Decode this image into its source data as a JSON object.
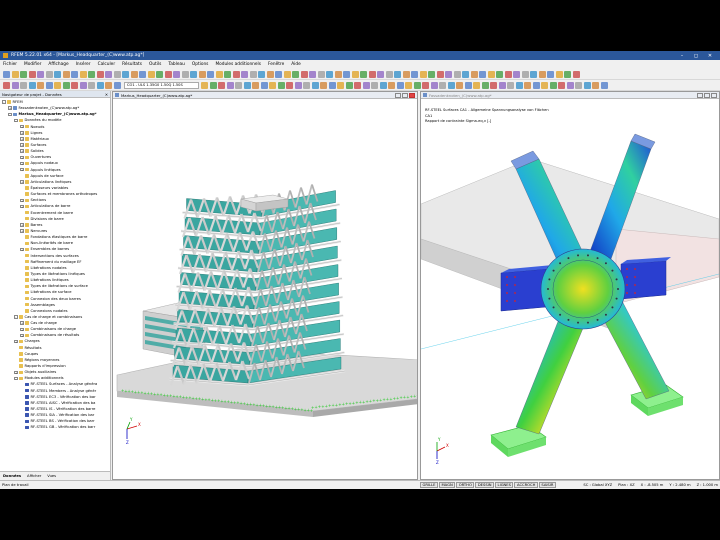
{
  "window": {
    "title": "RFEM 5.22.01 x64 - [Markus_Headquarter_(C)www.atp.ag*]",
    "buttons": [
      "–",
      "◻",
      "✕"
    ]
  },
  "menu": [
    "Fichier",
    "Modifier",
    "Affichage",
    "Insérer",
    "Calculer",
    "Résultats",
    "Outils",
    "Tableau",
    "Options",
    "Modules additionnels",
    "Fenêtre",
    "Aide"
  ],
  "toolbar": {
    "loadcase_combo": "CO1 - ULS 1.35G0 1.50Q 1.50S"
  },
  "navigator": {
    "title": "Navigateur de projet - Données",
    "close": "✕",
    "items": [
      {
        "level": 0,
        "exp": "-",
        "label": "RFEM",
        "icon": "folder"
      },
      {
        "level": 1,
        "exp": "+",
        "label": "Fassadenknoten_(C)www.atp.ag*",
        "icon": "model"
      },
      {
        "level": 1,
        "exp": "-",
        "label": "Markus_Headquarter_(C)www.atp.ag*",
        "icon": "model",
        "bold": true
      },
      {
        "level": 2,
        "exp": "-",
        "label": "Données du modèle",
        "icon": "folder"
      },
      {
        "level": 3,
        "exp": "+",
        "label": "Noeuds",
        "icon": "folder"
      },
      {
        "level": 3,
        "exp": "+",
        "label": "Lignes",
        "icon": "folder"
      },
      {
        "level": 3,
        "exp": "+",
        "label": "Matériaux",
        "icon": "folder"
      },
      {
        "level": 3,
        "exp": "+",
        "label": "Surfaces",
        "icon": "folder"
      },
      {
        "level": 3,
        "exp": "+",
        "label": "Solides",
        "icon": "folder"
      },
      {
        "level": 3,
        "exp": "+",
        "label": "Ouvertures",
        "icon": "folder"
      },
      {
        "level": 3,
        "exp": "+",
        "label": "Appuis nodaux",
        "icon": "folder"
      },
      {
        "level": 3,
        "exp": "+",
        "label": "Appuis linéiques",
        "icon": "folder"
      },
      {
        "level": 3,
        "exp": "",
        "label": "Appuis de surface",
        "icon": "folder"
      },
      {
        "level": 3,
        "exp": "+",
        "label": "Articulations linéiques",
        "icon": "folder"
      },
      {
        "level": 3,
        "exp": "",
        "label": "Épaisseurs variables",
        "icon": "folder"
      },
      {
        "level": 3,
        "exp": "",
        "label": "Surfaces et membranes orthotropes",
        "icon": "folder"
      },
      {
        "level": 3,
        "exp": "+",
        "label": "Sections",
        "icon": "folder"
      },
      {
        "level": 3,
        "exp": "+",
        "label": "Articulations de barre",
        "icon": "folder"
      },
      {
        "level": 3,
        "exp": "",
        "label": "Excentrement de barre",
        "icon": "folder"
      },
      {
        "level": 3,
        "exp": "",
        "label": "Divisions de barre",
        "icon": "folder"
      },
      {
        "level": 3,
        "exp": "+",
        "label": "Barres",
        "icon": "folder"
      },
      {
        "level": 3,
        "exp": "+",
        "label": "Nervures",
        "icon": "folder"
      },
      {
        "level": 3,
        "exp": "",
        "label": "Fondations élastiques de barre",
        "icon": "folder"
      },
      {
        "level": 3,
        "exp": "",
        "label": "Non-linéarités de barre",
        "icon": "folder"
      },
      {
        "level": 3,
        "exp": "+",
        "label": "Ensembles de barres",
        "icon": "folder"
      },
      {
        "level": 3,
        "exp": "",
        "label": "Intersections des surfaces",
        "icon": "folder"
      },
      {
        "level": 3,
        "exp": "",
        "label": "Raffinement du maillage EF",
        "icon": "folder"
      },
      {
        "level": 3,
        "exp": "",
        "label": "Libérations nodales",
        "icon": "folder"
      },
      {
        "level": 3,
        "exp": "",
        "label": "Types de libérations linéiques",
        "icon": "folder"
      },
      {
        "level": 3,
        "exp": "",
        "label": "Libérations linéiques",
        "icon": "folder"
      },
      {
        "level": 3,
        "exp": "",
        "label": "Types de libérations de surface",
        "icon": "folder"
      },
      {
        "level": 3,
        "exp": "",
        "label": "Libérations de surface",
        "icon": "folder"
      },
      {
        "level": 3,
        "exp": "",
        "label": "Connexion des deux barres",
        "icon": "folder"
      },
      {
        "level": 3,
        "exp": "",
        "label": "Assemblages",
        "icon": "folder"
      },
      {
        "level": 3,
        "exp": "",
        "label": "Connexions nodales",
        "icon": "folder"
      },
      {
        "level": 2,
        "exp": "-",
        "label": "Cas de charge et combinaisons",
        "icon": "folder"
      },
      {
        "level": 3,
        "exp": "+",
        "label": "Cas de charge",
        "icon": "folder"
      },
      {
        "level": 3,
        "exp": "+",
        "label": "Combinaisons de charge",
        "icon": "folder"
      },
      {
        "level": 3,
        "exp": "+",
        "label": "Combinaisons de résultats",
        "icon": "folder"
      },
      {
        "level": 2,
        "exp": "+",
        "label": "Charges",
        "icon": "folder"
      },
      {
        "level": 2,
        "exp": "",
        "label": "Résultats",
        "icon": "folder"
      },
      {
        "level": 2,
        "exp": "",
        "label": "Coupes",
        "icon": "folder"
      },
      {
        "level": 2,
        "exp": "",
        "label": "Régions moyennes",
        "icon": "folder"
      },
      {
        "level": 2,
        "exp": "",
        "label": "Rapports d'impression",
        "icon": "folder"
      },
      {
        "level": 2,
        "exp": "+",
        "label": "Objets auxiliaires",
        "icon": "folder"
      },
      {
        "level": 2,
        "exp": "-",
        "label": "Modules additionnels",
        "icon": "folder"
      },
      {
        "level": 3,
        "exp": "",
        "label": "RF-STEEL Surfaces - Analyse généra",
        "icon": "module"
      },
      {
        "level": 3,
        "exp": "",
        "label": "RF-STEEL Members - Analyse génér",
        "icon": "module"
      },
      {
        "level": 3,
        "exp": "",
        "label": "RF-STEEL EC3 - Vérification des bar",
        "icon": "module"
      },
      {
        "level": 3,
        "exp": "",
        "label": "RF-STEEL AISC - Vérification des ba",
        "icon": "module"
      },
      {
        "level": 3,
        "exp": "",
        "label": "RF-STEEL IS - Vérification des barre",
        "icon": "module"
      },
      {
        "level": 3,
        "exp": "",
        "label": "RF-STEEL SIA - Vérification des bar",
        "icon": "module"
      },
      {
        "level": 3,
        "exp": "",
        "label": "RF-STEEL BS - Vérification des barr",
        "icon": "module"
      },
      {
        "level": 3,
        "exp": "",
        "label": "RF-STEEL GB - Vérification des barr",
        "icon": "module"
      }
    ],
    "tabs": [
      "Données",
      "Afficher",
      "Vues"
    ]
  },
  "pane_left": {
    "title": "Markus_Headquarter_(C)www.atp.ag*"
  },
  "pane_right": {
    "title": "Fassadenknoten_(C)www.atp.ag*",
    "info_lines": [
      "RF-STEEL Surfaces CA1 - Allgemeine Spannungsanalyse von Flächen",
      "CA1",
      "Rapport de contrainte Sigma-eq,v [-]"
    ]
  },
  "axes": {
    "x": "X",
    "y": "Y",
    "z": "Z"
  },
  "statusbar": {
    "left": "Plan de travail",
    "buttons": [
      "GRILLE",
      "MAGN",
      "ORTHO",
      "DESSIN",
      "LIGNES",
      "ACCROCH",
      "SAISIR"
    ],
    "system": "SC : Global XYZ",
    "plane": "Plan : XZ",
    "coords": [
      "X : -8.505 m",
      "Y : 2.480 m",
      "Z : 1.000 m"
    ]
  },
  "colors": {
    "accent": "#2b579a",
    "building_glass": "#3aa6a0",
    "support": "#22c822",
    "stress_high": "#e82020",
    "stress_low": "#2040d8"
  }
}
